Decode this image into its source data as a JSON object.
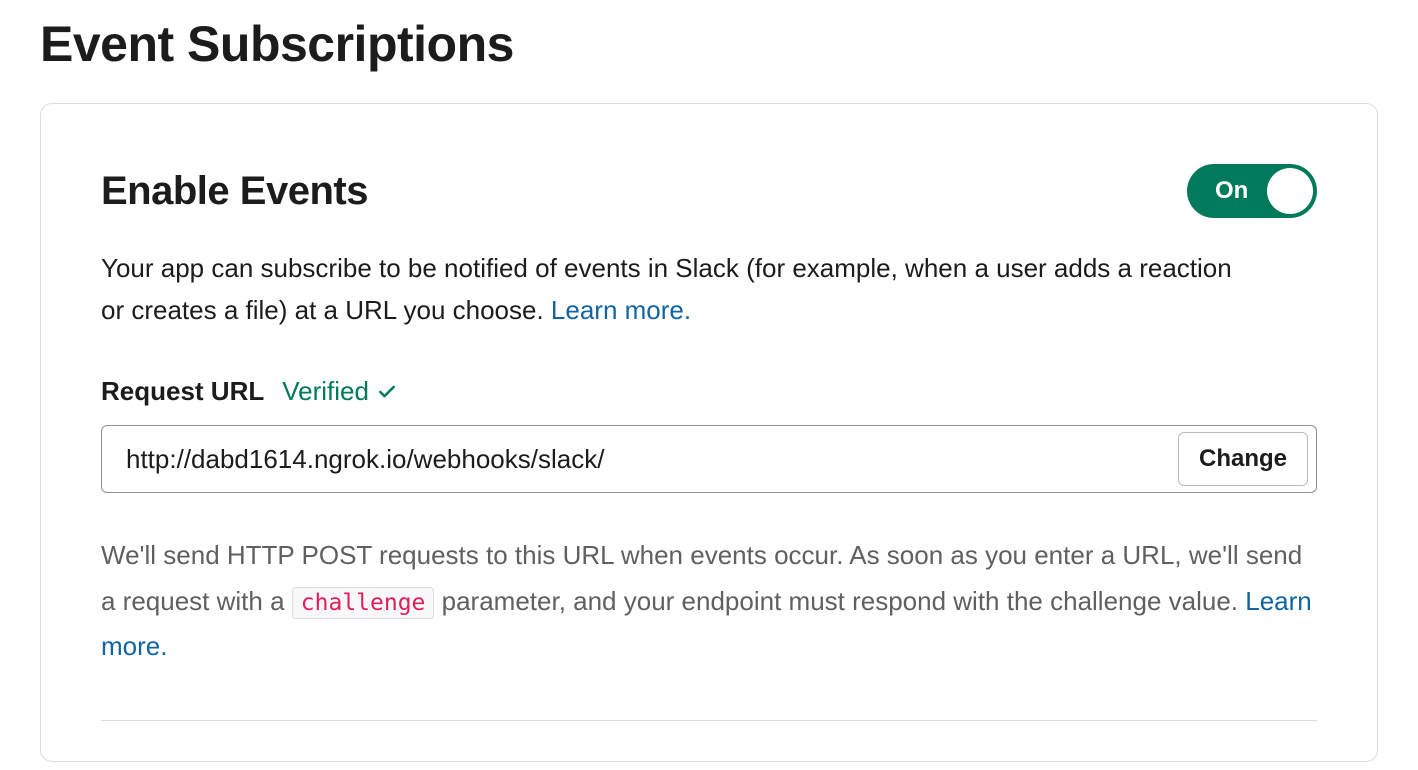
{
  "page": {
    "title": "Event Subscriptions"
  },
  "card": {
    "section_title": "Enable Events",
    "toggle": {
      "state_label": "On",
      "enabled": true
    },
    "description_part1": "Your app can subscribe to be notified of events in Slack (for example, when a user adds a reaction or creates a file) at a URL you choose. ",
    "learn_more_label": "Learn more.",
    "request_url": {
      "label": "Request URL",
      "status": "Verified",
      "value": "http://dabd1614.ngrok.io/webhooks/slack/",
      "change_button": "Change"
    },
    "help_text": {
      "part1": "We'll send HTTP POST requests to this URL when events occur. As soon as you enter a URL, we'll send a request with a ",
      "code": "challenge",
      "part2": " parameter, and your endpoint must respond with the challenge value. ",
      "learn_more": "Learn more."
    }
  }
}
